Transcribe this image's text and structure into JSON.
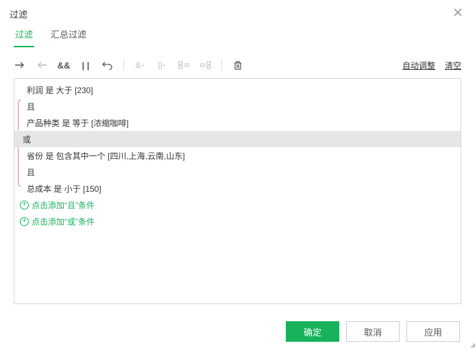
{
  "title": "过滤",
  "tabs": [
    {
      "label": "过滤",
      "active": true
    },
    {
      "label": "汇总过滤",
      "active": false
    }
  ],
  "toolbar_right": {
    "auto_adjust": "自动调整",
    "clear": "清空"
  },
  "rules": [
    {
      "text": "利润 是 大于 [230]",
      "kind": "cond"
    },
    {
      "text": "且",
      "kind": "and"
    },
    {
      "text": "产品种类 是 等于 [浓缩咖啡]",
      "kind": "cond"
    },
    {
      "text": "或",
      "kind": "or"
    },
    {
      "text": "省份 是 包含其中一个 [四川,上海,云南,山东]",
      "kind": "cond"
    },
    {
      "text": "且",
      "kind": "and"
    },
    {
      "text": "总成本 是 小于 [150]",
      "kind": "cond"
    }
  ],
  "add_and": "点击添加“且”条件",
  "add_or": "点击添加“或”条件",
  "buttons": {
    "ok": "确定",
    "cancel": "取消",
    "apply": "应用"
  }
}
